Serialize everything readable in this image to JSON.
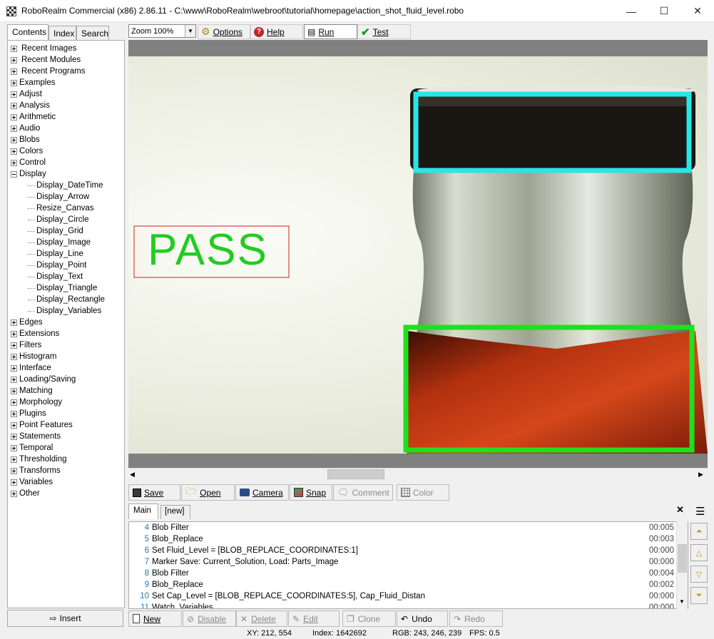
{
  "window": {
    "title": "RoboRealm Commercial (x86) 2.86.11 - C:\\www\\RoboRealm\\webroot\\tutorial\\homepage\\action_shot_fluid_level.robo",
    "minimize": "—",
    "maximize": "☐",
    "close": "✕"
  },
  "left_tabs": [
    "Contents",
    "Index",
    "Search"
  ],
  "tree": {
    "items": [
      {
        "label": "Recent Images",
        "level": 0,
        "state": "plus"
      },
      {
        "label": "Recent Modules",
        "level": 0,
        "state": "plus"
      },
      {
        "label": "Recent Programs",
        "level": 0,
        "state": "plus"
      },
      {
        "label": "Examples",
        "level": 0,
        "state": "plus"
      },
      {
        "label": "Adjust",
        "level": 0,
        "state": "plus"
      },
      {
        "label": "Analysis",
        "level": 0,
        "state": "plus"
      },
      {
        "label": "Arithmetic",
        "level": 0,
        "state": "plus"
      },
      {
        "label": "Audio",
        "level": 0,
        "state": "plus"
      },
      {
        "label": "Blobs",
        "level": 0,
        "state": "plus"
      },
      {
        "label": "Colors",
        "level": 0,
        "state": "plus"
      },
      {
        "label": "Control",
        "level": 0,
        "state": "plus"
      },
      {
        "label": "Display",
        "level": 0,
        "state": "minus"
      },
      {
        "label": "Display_DateTime",
        "level": 1
      },
      {
        "label": "Display_Arrow",
        "level": 1
      },
      {
        "label": "Resize_Canvas",
        "level": 1
      },
      {
        "label": "Display_Circle",
        "level": 1
      },
      {
        "label": "Display_Grid",
        "level": 1
      },
      {
        "label": "Display_Image",
        "level": 1
      },
      {
        "label": "Display_Line",
        "level": 1
      },
      {
        "label": "Display_Point",
        "level": 1
      },
      {
        "label": "Display_Text",
        "level": 1
      },
      {
        "label": "Display_Triangle",
        "level": 1
      },
      {
        "label": "Display_Rectangle",
        "level": 1
      },
      {
        "label": "Display_Variables",
        "level": 1
      },
      {
        "label": "Edges",
        "level": 0,
        "state": "plus"
      },
      {
        "label": "Extensions",
        "level": 0,
        "state": "plus"
      },
      {
        "label": "Filters",
        "level": 0,
        "state": "plus"
      },
      {
        "label": "Histogram",
        "level": 0,
        "state": "plus"
      },
      {
        "label": "Interface",
        "level": 0,
        "state": "plus"
      },
      {
        "label": "Loading/Saving",
        "level": 0,
        "state": "plus"
      },
      {
        "label": "Matching",
        "level": 0,
        "state": "plus"
      },
      {
        "label": "Morphology",
        "level": 0,
        "state": "plus"
      },
      {
        "label": "Plugins",
        "level": 0,
        "state": "plus"
      },
      {
        "label": "Point Features",
        "level": 0,
        "state": "plus"
      },
      {
        "label": "Statements",
        "level": 0,
        "state": "plus"
      },
      {
        "label": "Temporal",
        "level": 0,
        "state": "plus"
      },
      {
        "label": "Thresholding",
        "level": 0,
        "state": "plus"
      },
      {
        "label": "Transforms",
        "level": 0,
        "state": "plus"
      },
      {
        "label": "Variables",
        "level": 0,
        "state": "plus"
      },
      {
        "label": "Other",
        "level": 0,
        "state": "plus"
      }
    ]
  },
  "insert_label": "Insert",
  "toolbar": {
    "zoom_value": "Zoom 100%",
    "options_label": "Options",
    "help_label": "Help",
    "run_label": "Run",
    "test_label": "Test"
  },
  "overlay": {
    "pass_text": "PASS"
  },
  "image_toolbar": {
    "save": "Save",
    "open": "Open",
    "camera": "Camera",
    "snap": "Snap",
    "comment": "Comment",
    "color": "Color"
  },
  "program_tabs": [
    "Main",
    "[new]"
  ],
  "program_close": "✕",
  "program_menu": "☰",
  "program": {
    "rows": [
      {
        "num": "4",
        "text": "Blob Filter",
        "time": "00:005"
      },
      {
        "num": "5",
        "text": "Blob_Replace",
        "time": "00:003"
      },
      {
        "num": "6",
        "text": "Set Fluid_Level = [BLOB_REPLACE_COORDINATES:1]",
        "time": "00:000"
      },
      {
        "num": "7",
        "text": "Marker Save: Current_Solution, Load: Parts_Image",
        "time": "00:000"
      },
      {
        "num": "8",
        "text": "Blob Filter",
        "time": "00:004"
      },
      {
        "num": "9",
        "text": "Blob_Replace",
        "time": "00:002"
      },
      {
        "num": "10",
        "text": "Set Cap_Level = [BLOB_REPLACE_COORDINATES:5], Cap_Fluid_Distan",
        "time": "00:000"
      },
      {
        "num": "11",
        "text": "Watch_Variables",
        "time": "00:000"
      }
    ]
  },
  "program_toolbar": {
    "new": "New",
    "disable": "Disable",
    "delete": "Delete",
    "edit": "Edit",
    "clone": "Clone",
    "undo": "Undo",
    "redo": "Redo"
  },
  "status": {
    "xy": "XY: 212, 554",
    "index": "Index: 1642692",
    "rgb": "RGB: 243, 246, 239",
    "fps": "FPS: 0.5"
  },
  "colors": {
    "cap_box": "#29e6e6",
    "fluid_box": "#1ee01e",
    "pass_text": "#22cc22",
    "pass_box": "#cc2222"
  }
}
